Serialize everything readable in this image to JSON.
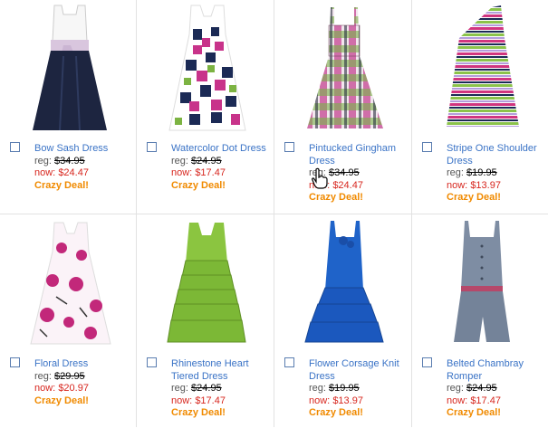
{
  "products": [
    {
      "name": "Bow Sash Dress",
      "reg_label": "reg:",
      "reg_price": "$34.95",
      "now_label": "now:",
      "now_price": "$24.47",
      "deal": "Crazy Deal!",
      "icon": "bow-sash-dress-image"
    },
    {
      "name": "Watercolor Dot Dress",
      "reg_label": "reg:",
      "reg_price": "$24.95",
      "now_label": "now:",
      "now_price": "$17.47",
      "deal": "Crazy Deal!",
      "icon": "watercolor-dot-dress-image"
    },
    {
      "name": "Pintucked Gingham Dress",
      "reg_label": "reg:",
      "reg_price": "$34.95",
      "now_label": "now:",
      "now_price": "$24.47",
      "deal": "Crazy Deal!",
      "icon": "gingham-dress-image"
    },
    {
      "name": "Stripe One Shoulder Dress",
      "reg_label": "reg:",
      "reg_price": "$19.95",
      "now_label": "now:",
      "now_price": "$13.97",
      "deal": "Crazy Deal!",
      "icon": "stripe-dress-image"
    },
    {
      "name": "Floral Dress",
      "reg_label": "reg:",
      "reg_price": "$29.95",
      "now_label": "now:",
      "now_price": "$20.97",
      "deal": "Crazy Deal!",
      "icon": "floral-dress-image"
    },
    {
      "name": "Rhinestone Heart Tiered Dress",
      "reg_label": "reg:",
      "reg_price": "$24.95",
      "now_label": "now:",
      "now_price": "$17.47",
      "deal": "Crazy Deal!",
      "icon": "tiered-dress-image"
    },
    {
      "name": "Flower Corsage Knit Dress",
      "reg_label": "reg:",
      "reg_price": "$19.95",
      "now_label": "now:",
      "now_price": "$13.97",
      "deal": "Crazy Deal!",
      "icon": "corsage-dress-image"
    },
    {
      "name": "Belted Chambray Romper",
      "reg_label": "reg:",
      "reg_price": "$24.95",
      "now_label": "now:",
      "now_price": "$17.47",
      "deal": "Crazy Deal!",
      "icon": "chambray-romper-image"
    }
  ],
  "colors": {
    "link": "#3a73c6",
    "sale": "#d7261e",
    "deal": "#f08a00",
    "checkbox": "#5a7db0"
  }
}
